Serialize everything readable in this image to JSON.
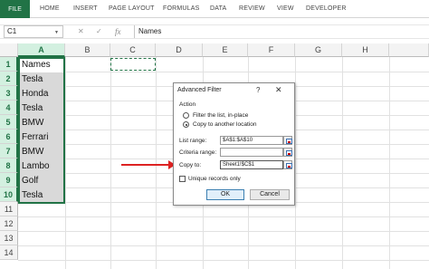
{
  "ribbon": {
    "file": "FILE",
    "tabs": [
      "HOME",
      "INSERT",
      "PAGE LAYOUT",
      "FORMULAS",
      "DATA",
      "REVIEW",
      "VIEW",
      "DEVELOPER"
    ]
  },
  "formula_bar": {
    "name_box": "C1",
    "cancel": "✕",
    "enter": "✓",
    "fx": "fx",
    "content": "Names"
  },
  "columns": [
    "A",
    "B",
    "C",
    "D",
    "E",
    "F",
    "G",
    "H"
  ],
  "rows": [
    "1",
    "2",
    "3",
    "4",
    "5",
    "6",
    "7",
    "8",
    "9",
    "10",
    "11",
    "12",
    "13",
    "14"
  ],
  "column_a": [
    "Names",
    "Tesla",
    "Honda",
    "Tesla",
    "BMW",
    "Ferrari",
    "BMW",
    "Lambo",
    "Golf",
    "Tesla"
  ],
  "dialog": {
    "title": "Advanced Filter",
    "help": "?",
    "close": "✕",
    "action_label": "Action",
    "radio_filter": "Filter the list, in-place",
    "radio_copy": "Copy to another location",
    "list_range_label": "List range:",
    "list_range_value": "$A$1:$A$10",
    "criteria_range_label": "Criteria range:",
    "criteria_range_value": "",
    "copy_to_label": "Copy to:",
    "copy_to_value": "Sheet1!$C$1",
    "unique_label": "Unique records only",
    "ok": "OK",
    "cancel": "Cancel"
  },
  "colors": {
    "accent": "#217346",
    "arrow": "#dd2222"
  }
}
